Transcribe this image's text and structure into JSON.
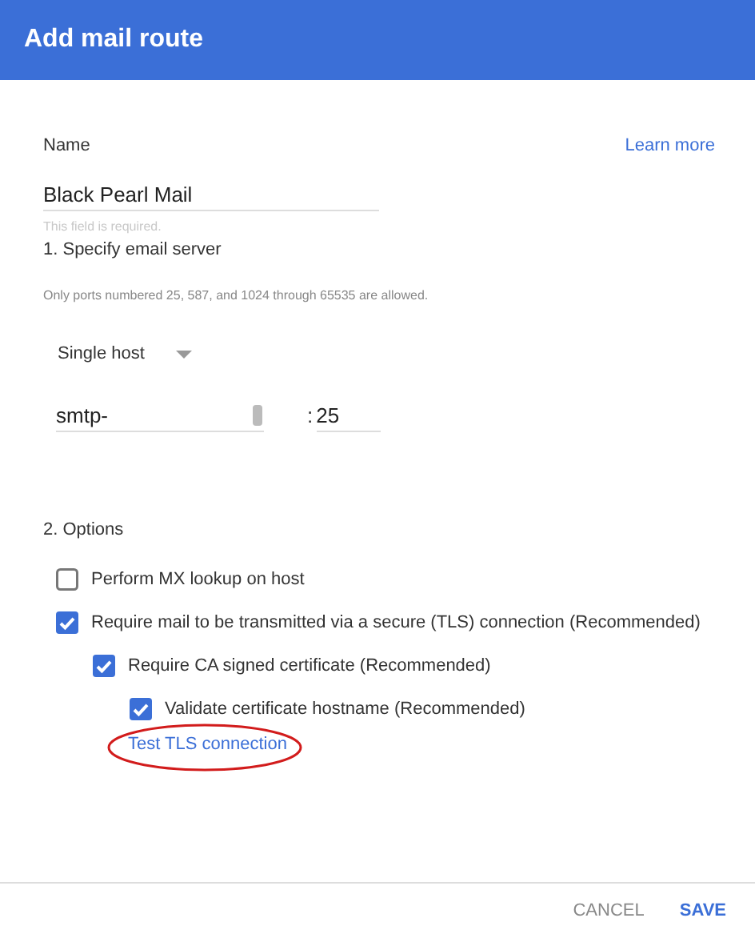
{
  "dialog": {
    "title": "Add mail route"
  },
  "name_field": {
    "label": "Name",
    "value": "Black Pearl Mail",
    "hint": "This field is required."
  },
  "learn_more": "Learn more",
  "server_section": {
    "heading": "1. Specify email server",
    "note": "Only ports numbered 25, 587, and 1024 through 65535 are allowed.",
    "host_type": "Single host",
    "host": "smtp-",
    "separator": ":",
    "port": "25"
  },
  "options_section": {
    "heading": "2. Options",
    "checkboxes": [
      {
        "label": "Perform MX lookup on host",
        "checked": false
      },
      {
        "label": "Require mail to be transmitted via a secure (TLS) connection (Recommended)",
        "checked": true,
        "children": [
          {
            "label": "Require CA signed certificate (Recommended)",
            "checked": true,
            "children": [
              {
                "label": "Validate certificate hostname (Recommended)",
                "checked": true
              }
            ]
          }
        ]
      }
    ],
    "test_link": "Test TLS connection"
  },
  "buttons": [
    {
      "label": "CANCEL",
      "kind": "secondary"
    },
    {
      "label": "SAVE",
      "kind": "primary"
    }
  ]
}
